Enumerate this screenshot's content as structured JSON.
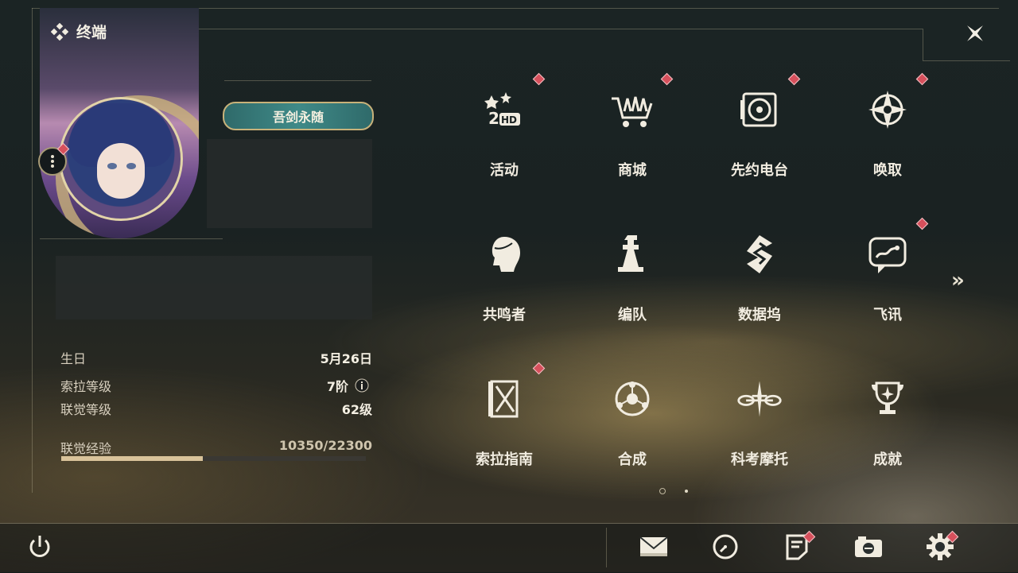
{
  "panel": {
    "title": "终端"
  },
  "profile": {
    "title_badge": "吾剑永随",
    "stats": [
      {
        "label": "生日",
        "value": "5月26日"
      },
      {
        "label": "索拉等级",
        "value": "7阶"
      },
      {
        "label": "联觉等级",
        "value": "62级"
      }
    ],
    "exp": {
      "label": "联觉经验",
      "value": "10350/22300",
      "current": 10350,
      "max": 22300
    }
  },
  "menu": {
    "items": [
      {
        "label": "活动",
        "icon": "event-2hd-icon",
        "badge": true
      },
      {
        "label": "商城",
        "icon": "shop-cart-icon",
        "badge": true
      },
      {
        "label": "先约电台",
        "icon": "radio-record-icon",
        "badge": true
      },
      {
        "label": "唤取",
        "icon": "convene-compass-icon",
        "badge": true
      },
      {
        "label": "共鸣者",
        "icon": "resonator-head-icon",
        "badge": false
      },
      {
        "label": "编队",
        "icon": "team-chess-icon",
        "badge": false
      },
      {
        "label": "数据坞",
        "icon": "data-bank-icon",
        "badge": false
      },
      {
        "label": "飞讯",
        "icon": "message-chat-icon",
        "badge": true
      },
      {
        "label": "索拉指南",
        "icon": "guide-book-icon",
        "badge": true
      },
      {
        "label": "合成",
        "icon": "synthesis-icon",
        "badge": false
      },
      {
        "label": "科考摩托",
        "icon": "motorcycle-icon",
        "badge": false
      },
      {
        "label": "成就",
        "icon": "trophy-icon",
        "badge": false
      }
    ],
    "next_page": "»",
    "pages": 2,
    "current_page": 1
  },
  "bottom_bar": {
    "items": [
      {
        "icon": "power-icon"
      },
      {
        "icon": "mail-icon"
      },
      {
        "icon": "clock-icon"
      },
      {
        "icon": "notice-icon",
        "badge": true
      },
      {
        "icon": "camera-icon"
      },
      {
        "icon": "settings-gear-icon",
        "badge": true
      }
    ]
  },
  "colors": {
    "accent_gold": "#c8b27a",
    "badge_red": "#d6505c",
    "text": "#f1ece0"
  }
}
